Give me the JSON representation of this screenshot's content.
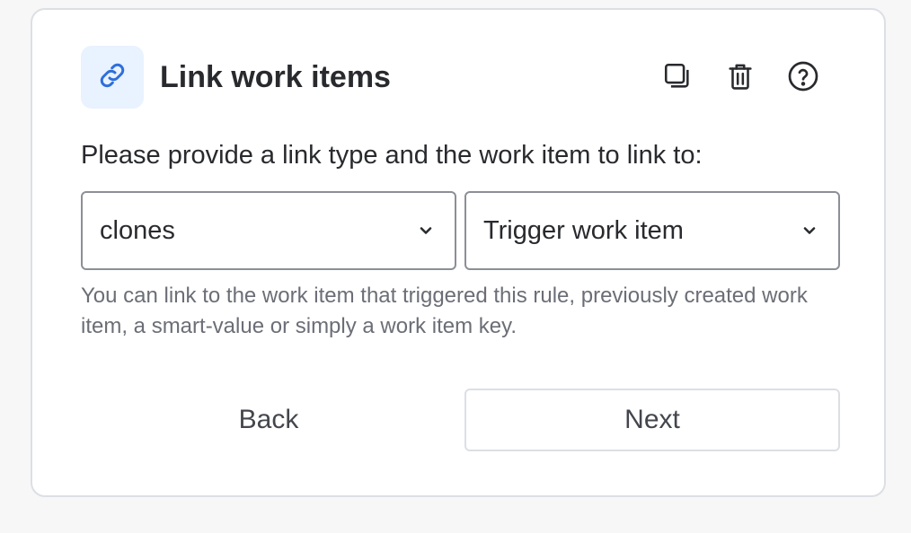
{
  "card": {
    "title": "Link work items",
    "header_icon": "link-icon",
    "actions": [
      "duplicate-icon",
      "trash-icon",
      "help-icon"
    ]
  },
  "form": {
    "instructions": "Please provide a link type and the work item to link to:",
    "link_type": {
      "value": "clones"
    },
    "target": {
      "value": "Trigger work item"
    },
    "helper": "You can link to the work item that triggered this rule, previously created work item, a smart-value or simply a work item key."
  },
  "buttons": {
    "back": "Back",
    "next": "Next"
  },
  "colors": {
    "accent": "#2f6fdb",
    "icon_tile": "#e9f2ff",
    "border": "#8c8f97"
  }
}
